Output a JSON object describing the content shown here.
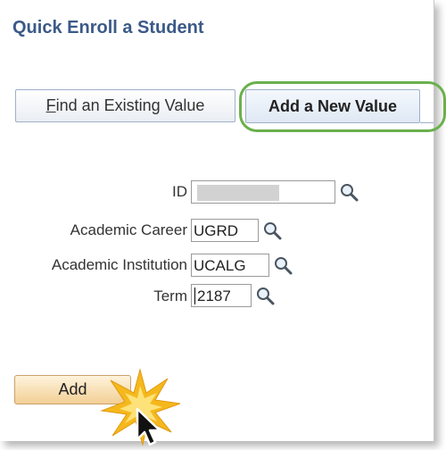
{
  "page_title": "Quick Enroll a Student",
  "tabs": {
    "find_label": "Find an Existing Value",
    "find_accesskey": "F",
    "add_label": "Add a New Value"
  },
  "form": {
    "id_label": "ID",
    "id_value": "",
    "career_label": "Academic Career",
    "career_value": "UGRD",
    "institution_label": "Academic Institution",
    "institution_value": "UCALG",
    "term_label": "Term",
    "term_value": "2187"
  },
  "add_button_label": "Add",
  "colors": {
    "title": "#3b5a88",
    "tab_highlight_ring": "#6ab04c",
    "add_button": "#f3cf95",
    "click_burst": "#f5b81c"
  },
  "icons": {
    "lookup": "magnifying-glass-icon",
    "cursor": "mouse-pointer-icon",
    "click": "click-burst-icon"
  }
}
